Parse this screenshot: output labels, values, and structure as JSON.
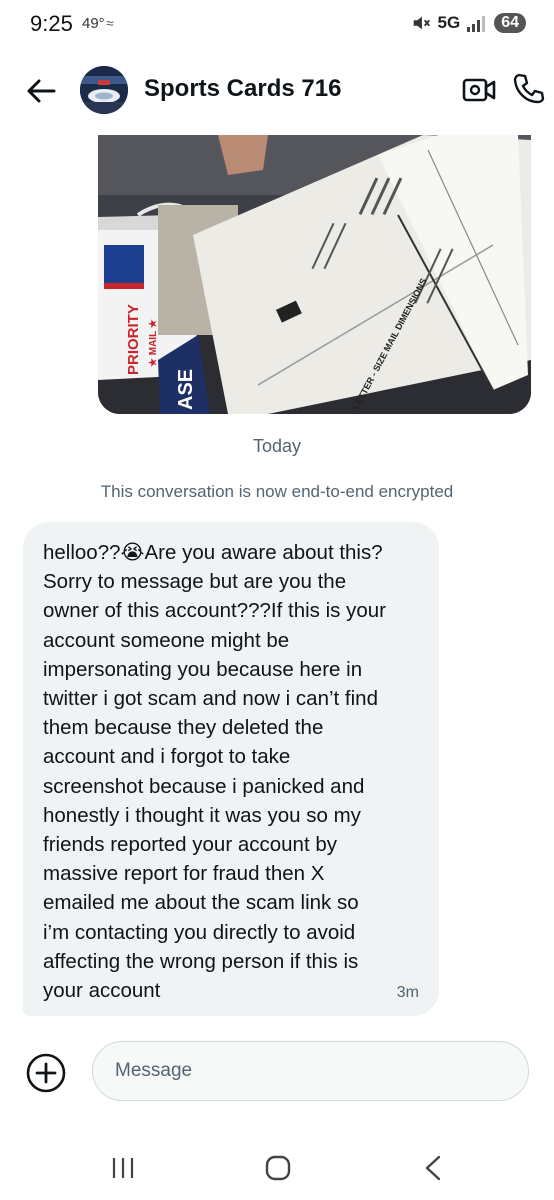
{
  "status_bar": {
    "time": "9:25",
    "temperature": "49°",
    "network": "5G",
    "battery": "64"
  },
  "header": {
    "contact_name": "Sports Cards 716",
    "avatar_icon": "stadium-avatar",
    "back_icon": "arrow-left-icon",
    "video_icon": "video-camera-icon",
    "call_icon": "phone-icon"
  },
  "conversation": {
    "image_message": {
      "printed_text": [
        "PRIORITY",
        "★ MAIL ★",
        "LETTER - SIZE MAIL DIMENSIONS",
        "ASE"
      ],
      "description_icon": "photo-envelope"
    },
    "date_separator": "Today",
    "encryption_notice": "This conversation is now end-to-end encrypted",
    "message": {
      "text": "helloo??😭Are you aware about this?\nSorry to message but are you the\nowner of this account???If this is your\naccount someone might be\nimpersonating you because here in\ntwitter i got scam and now i can’t find\nthem because they deleted the\naccount and i forgot to take\nscreenshot because i panicked and\nhonestly i thought it was you so my\nfriends reported your account by\nmassive report for fraud then X\nemailed me about the scam link so\ni’m contacting you directly to avoid\naffecting the wrong person if this is\nyour account",
      "time": "3m"
    }
  },
  "composer": {
    "placeholder": "Message",
    "value": "",
    "add_icon": "plus-circle-icon"
  },
  "nav_bar": {
    "recents_icon": "recents-icon",
    "home_icon": "home-icon",
    "back_icon": "back-chevron-icon"
  },
  "colors": {
    "bubble_bg": "#eff3f4",
    "secondary_text": "#536471",
    "primary_text": "#0f1419"
  }
}
